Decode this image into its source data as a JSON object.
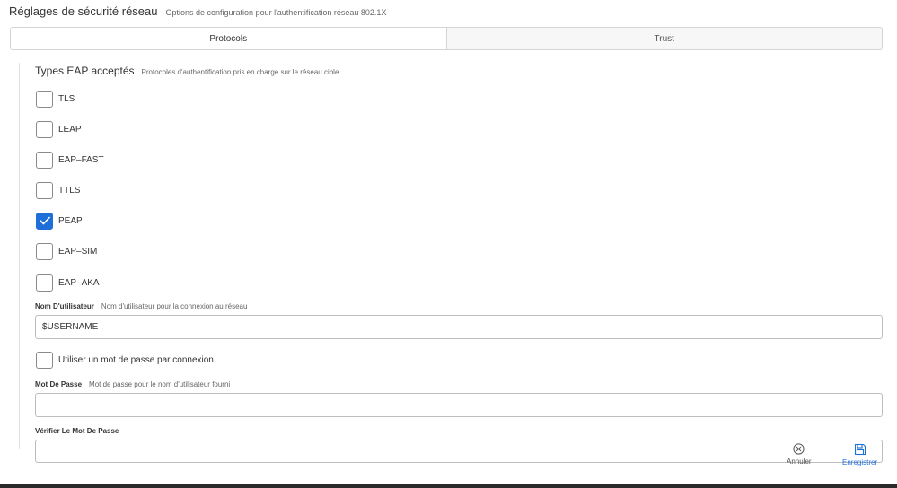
{
  "header": {
    "title": "Réglages de sécurité réseau",
    "subtitle": "Options de configuration pour l'authentification réseau 802.1X"
  },
  "tabs": [
    {
      "label": "Protocols",
      "active": true
    },
    {
      "label": "Trust",
      "active": false
    }
  ],
  "eap": {
    "title": "Types EAP acceptés",
    "hint": "Protocoles d'authentification pris en charge sur le réseau cible",
    "items": [
      {
        "label": "TLS",
        "checked": false
      },
      {
        "label": "LEAP",
        "checked": false
      },
      {
        "label": "EAP–FAST",
        "checked": false
      },
      {
        "label": "TTLS",
        "checked": false
      },
      {
        "label": "PEAP",
        "checked": true
      },
      {
        "label": "EAP–SIM",
        "checked": false
      },
      {
        "label": "EAP–AKA",
        "checked": false
      }
    ]
  },
  "username": {
    "label": "Nom D'utilisateur",
    "hint": "Nom d'utilisateur pour la connexion au réseau",
    "value": "$USERNAME"
  },
  "per_connection_password": {
    "label": "Utiliser un mot de passe par connexion",
    "checked": false
  },
  "password": {
    "label": "Mot De Passe",
    "hint": "Mot de passe pour le nom d'utilisateur fourni",
    "value": ""
  },
  "verify_password": {
    "label": "Vérifier Le Mot De Passe",
    "value": ""
  },
  "footer": {
    "cancel_label": "Annuler",
    "save_label": "Enregistrer",
    "accent_color": "#1f6fd8"
  }
}
